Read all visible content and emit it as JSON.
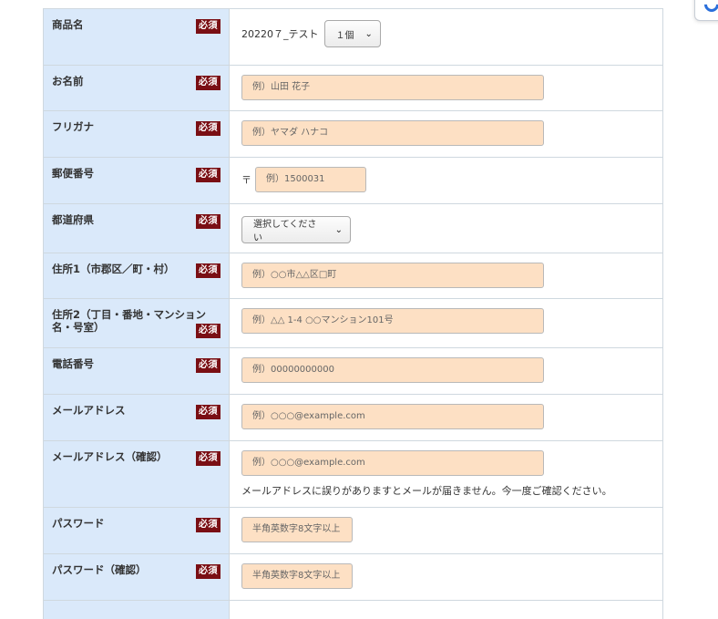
{
  "required_badge": "必須",
  "product": {
    "label": "商品名",
    "name": "20220７_テスト",
    "quantity_selected": "１個"
  },
  "fields": {
    "name": {
      "label": "お名前",
      "placeholder": "例）山田 花子"
    },
    "furigana": {
      "label": "フリガナ",
      "placeholder": "例）ヤマダ ハナコ"
    },
    "postal": {
      "label": "郵便番号",
      "mark": "〒",
      "placeholder": "例）1500031"
    },
    "prefecture": {
      "label": "都道府県",
      "selected": "選択してください"
    },
    "address1": {
      "label": "住所1（市郡区／町・村）",
      "placeholder": "例）○○市△△区□町"
    },
    "address2": {
      "label": "住所2（丁目・番地・マンション名・号室）",
      "placeholder": "例）△△ 1-4 ○○マンション101号"
    },
    "phone": {
      "label": "電話番号",
      "placeholder": "例）00000000000"
    },
    "email": {
      "label": "メールアドレス",
      "placeholder": "例）○○○@example.com"
    },
    "email_confirm": {
      "label": "メールアドレス（確認）",
      "placeholder": "例）○○○@example.com",
      "note": "メールアドレスに誤りがありますとメールが届きません。今一度ご確認ください。"
    },
    "password": {
      "label": "パスワード",
      "placeholder": "半角英数字8文字以上"
    },
    "password_confirm": {
      "label": "パスワード（確認）",
      "placeholder": "半角英数字8文字以上"
    }
  },
  "colors": {
    "label_bg": "#dae9fa",
    "required_bg": "#7a0f14",
    "input_bg": "#fde0c4",
    "border": "#cfd8df"
  }
}
